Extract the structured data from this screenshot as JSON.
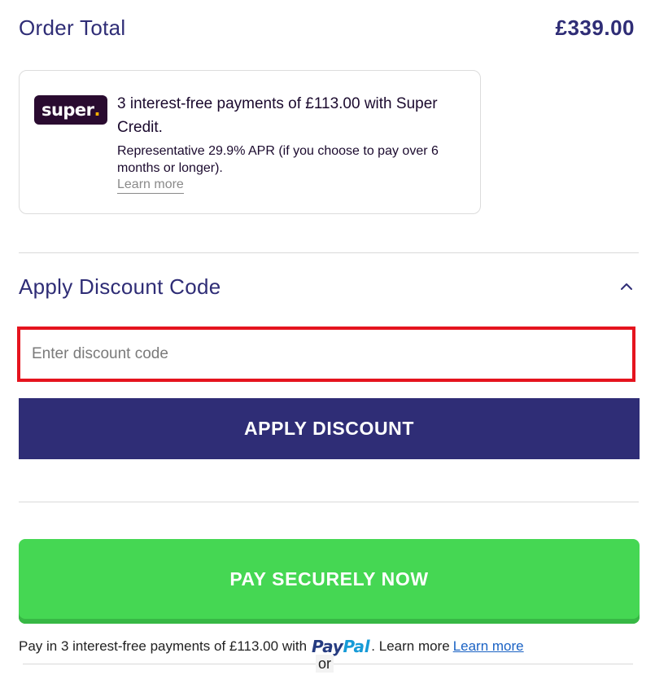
{
  "order": {
    "title": "Order Total",
    "amount": "£339.00"
  },
  "credit": {
    "logo_text": "super",
    "logo_dot": ".",
    "headline": "3 interest-free payments of £113.00 with Super Credit.",
    "apr_text": "Representative 29.9% APR (if you choose to pay over 6 months or longer).",
    "learn_more": "Learn more"
  },
  "discount": {
    "title": "Apply Discount Code",
    "toggle_icon": "chevron-up-icon",
    "placeholder": "Enter discount code",
    "value": "",
    "apply_label": "APPLY DISCOUNT"
  },
  "pay": {
    "button_label": "PAY SECURELY NOW"
  },
  "paypal": {
    "prefix": "Pay in 3 interest-free payments of £113.00 with",
    "logo_part1": "Pay",
    "logo_part2": "Pal",
    "suffix": ". Learn more",
    "learn_more_link": "Learn more"
  },
  "separator": {
    "or_text": "or"
  },
  "colors": {
    "brand_navy": "#2f2d76",
    "pay_green": "#45d753",
    "highlight_red": "#e5141e",
    "super_purple": "#2a0b30",
    "super_dot": "#ffb100",
    "paypal_dark": "#253b80",
    "paypal_light": "#179bd7"
  }
}
